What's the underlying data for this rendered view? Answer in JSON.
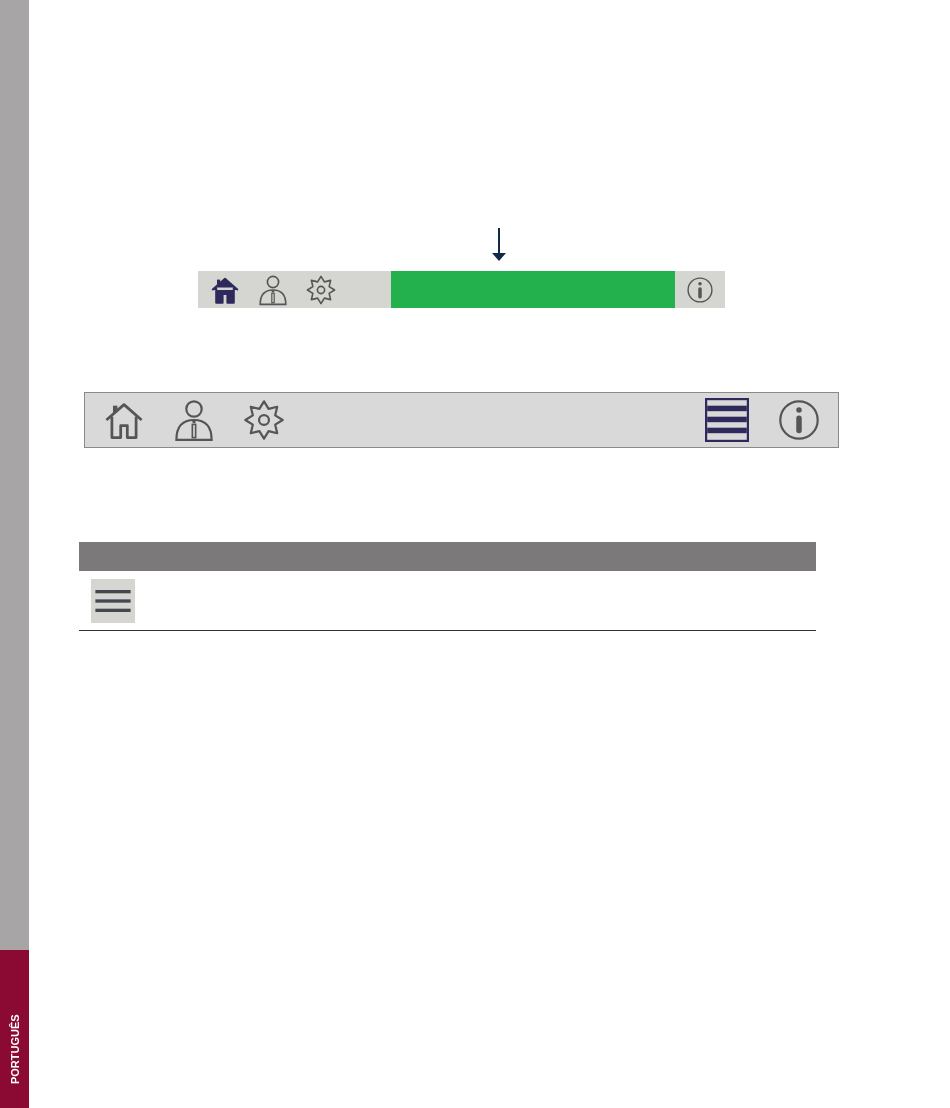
{
  "side_tab": {
    "label": "PORTUGUÊS"
  },
  "status_bar": {
    "buttons": [
      {
        "kind": "home",
        "selected": true
      },
      {
        "kind": "user",
        "selected": false
      },
      {
        "kind": "settings",
        "selected": false
      },
      {
        "kind": "info",
        "selected": false
      }
    ]
  },
  "toolbar": {
    "buttons": [
      {
        "kind": "home",
        "selected": false
      },
      {
        "kind": "user",
        "selected": false
      },
      {
        "kind": "settings",
        "selected": false
      },
      {
        "kind": "menu",
        "selected": true
      },
      {
        "kind": "info",
        "selected": false
      }
    ]
  },
  "table": {
    "rows": [
      {
        "kind": "menu"
      }
    ]
  }
}
